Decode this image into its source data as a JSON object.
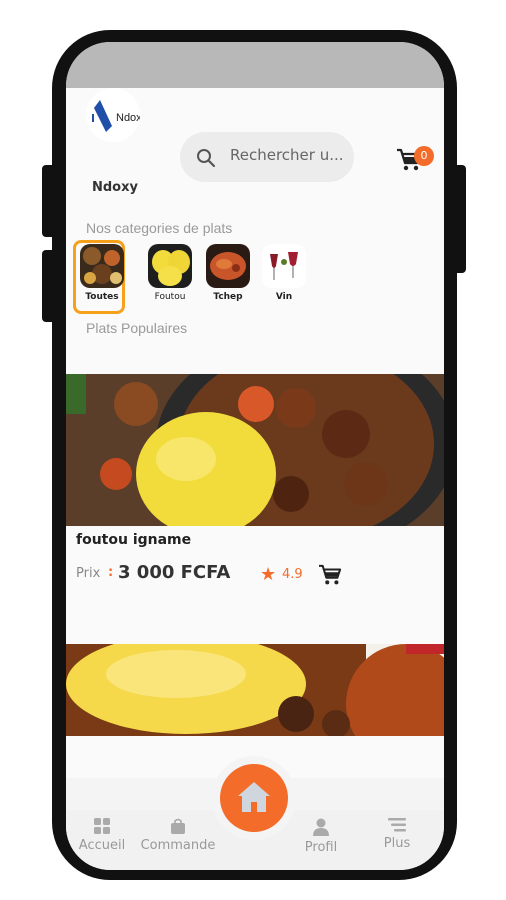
{
  "header": {
    "logo_text": "Ndox",
    "brand_name": "Ndoxy",
    "search_placeholder": "Rechercher u...",
    "cart_count": "0"
  },
  "categories": {
    "title": "Nos categories de plats",
    "items": [
      {
        "label": "Toutes",
        "selected": true
      },
      {
        "label": "Foutou",
        "selected": false
      },
      {
        "label": "Tchep",
        "selected": false
      },
      {
        "label": "Vin",
        "selected": false
      }
    ]
  },
  "popular": {
    "title": "Plats Populaires",
    "dishes": [
      {
        "name": "foutou igname",
        "price_label": "Prix",
        "price_sep": ":",
        "price": "3 000 FCFA",
        "rating": "4.9"
      }
    ]
  },
  "nav": {
    "items": [
      {
        "label": "Accueil"
      },
      {
        "label": "Commande"
      },
      {
        "label": "Profil"
      },
      {
        "label": "Plus"
      }
    ]
  },
  "colors": {
    "accent": "#f36c2a",
    "highlight": "#f5a11c"
  }
}
